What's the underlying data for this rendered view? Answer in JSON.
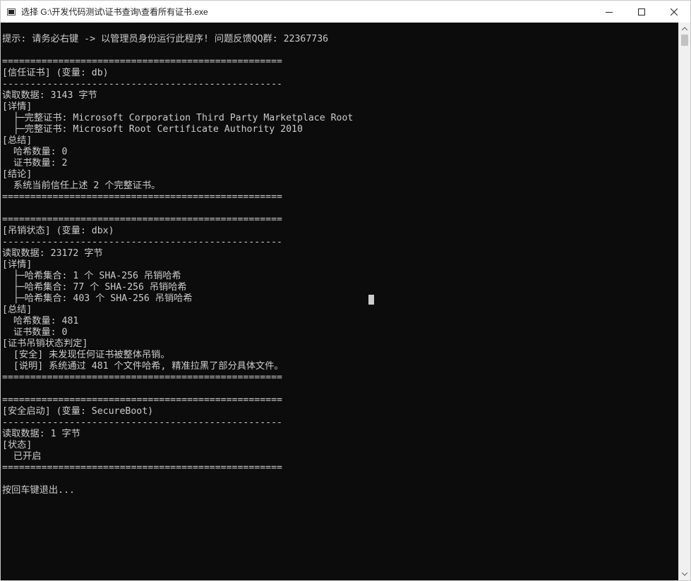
{
  "window": {
    "title": "选择 G:\\开发代码测试\\证书查询\\查看所有证书.exe",
    "icon": "console-app-icon",
    "controls": [
      "minimize-icon",
      "maximize-icon",
      "close-icon"
    ]
  },
  "colors": {
    "console_bg": "#0c0c0c",
    "console_text": "#cccccc",
    "titlebar_bg": "#ffffff"
  },
  "console": {
    "lines": [
      "提示: 请务必右键 -> 以管理员身份运行此程序! 问题反馈QQ群: 22367736",
      "",
      "==================================================",
      "[信任证书] (变量: db)",
      "--------------------------------------------------",
      "读取数据: 3143 字节",
      "[详情]",
      "  ├─完整证书: Microsoft Corporation Third Party Marketplace Root",
      "  ├─完整证书: Microsoft Root Certificate Authority 2010",
      "[总结]",
      "  哈希数量: 0",
      "  证书数量: 2",
      "[结论]",
      "  系统当前信任上述 2 个完整证书。",
      "==================================================",
      "",
      "==================================================",
      "[吊销状态] (变量: dbx)",
      "--------------------------------------------------",
      "读取数据: 23172 字节",
      "[详情]",
      "  ├─哈希集合: 1 个 SHA-256 吊销哈希",
      "  ├─哈希集合: 77 个 SHA-256 吊销哈希",
      "  ├─哈希集合: 403 个 SHA-256 吊销哈希",
      "[总结]",
      "  哈希数量: 481",
      "  证书数量: 0",
      "[证书吊销状态判定]",
      "  [安全] 未发现任何证书被整体吊销。",
      "  [说明] 系统通过 481 个文件哈希, 精准拉黑了部分具体文件。",
      "==================================================",
      "",
      "==================================================",
      "[安全启动] (变量: SecureBoot)",
      "--------------------------------------------------",
      "读取数据: 1 字节",
      "[状态]",
      "  已开启",
      "==================================================",
      "",
      "按回车键退出..."
    ]
  }
}
